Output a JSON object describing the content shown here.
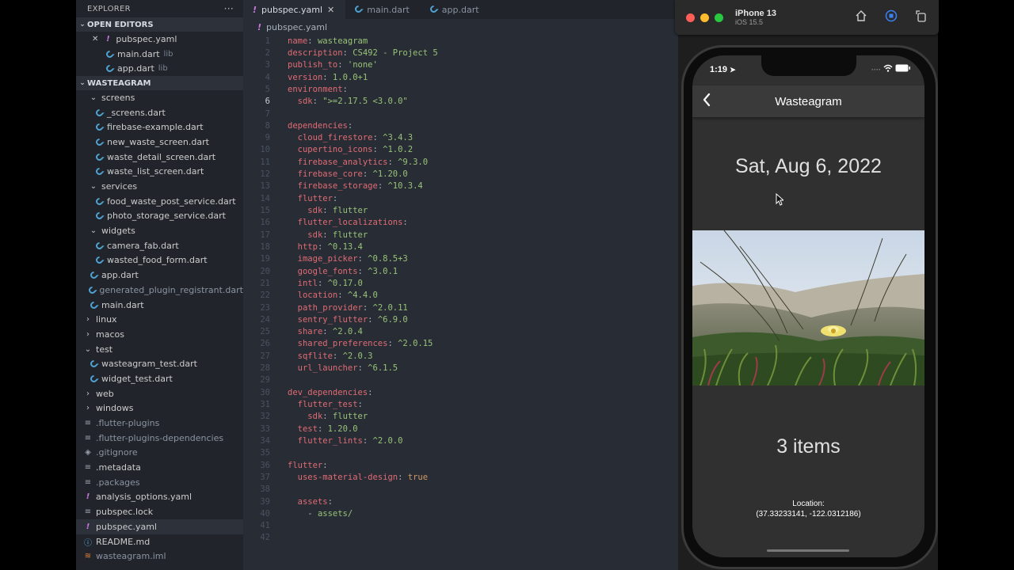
{
  "explorer": {
    "title": "EXPLORER",
    "more": "···",
    "open_editors_label": "OPEN EDITORS",
    "open_editors": [
      {
        "name": "pubspec.yaml",
        "sub": "",
        "icon": "yaml-icon"
      },
      {
        "name": "main.dart",
        "sub": "lib",
        "icon": "dart-icon"
      },
      {
        "name": "app.dart",
        "sub": "lib",
        "icon": "dart-icon"
      }
    ],
    "project_label": "WASTEAGRAM",
    "tree": [
      {
        "name": "screens",
        "type": "folder-open",
        "indent": 1
      },
      {
        "name": "_screens.dart",
        "type": "dart",
        "indent": 2
      },
      {
        "name": "firebase-example.dart",
        "type": "dart",
        "indent": 2
      },
      {
        "name": "new_waste_screen.dart",
        "type": "dart",
        "indent": 2
      },
      {
        "name": "waste_detail_screen.dart",
        "type": "dart",
        "indent": 2
      },
      {
        "name": "waste_list_screen.dart",
        "type": "dart",
        "indent": 2
      },
      {
        "name": "services",
        "type": "folder-open",
        "indent": 1
      },
      {
        "name": "food_waste_post_service.dart",
        "type": "dart",
        "indent": 2
      },
      {
        "name": "photo_storage_service.dart",
        "type": "dart",
        "indent": 2
      },
      {
        "name": "widgets",
        "type": "folder-open",
        "indent": 1
      },
      {
        "name": "camera_fab.dart",
        "type": "dart",
        "indent": 2
      },
      {
        "name": "wasted_food_form.dart",
        "type": "dart",
        "indent": 2
      },
      {
        "name": "app.dart",
        "type": "dart",
        "indent": 1
      },
      {
        "name": "generated_plugin_registrant.dart",
        "type": "dart-dim",
        "indent": 1
      },
      {
        "name": "main.dart",
        "type": "dart",
        "indent": 1
      },
      {
        "name": "linux",
        "type": "folder",
        "indent": 0
      },
      {
        "name": "macos",
        "type": "folder",
        "indent": 0
      },
      {
        "name": "test",
        "type": "folder-open",
        "indent": 0
      },
      {
        "name": "wasteagram_test.dart",
        "type": "dart",
        "indent": 1
      },
      {
        "name": "widget_test.dart",
        "type": "dart",
        "indent": 1
      },
      {
        "name": "web",
        "type": "folder",
        "indent": 0
      },
      {
        "name": "windows",
        "type": "folder",
        "indent": 0
      },
      {
        "name": ".flutter-plugins",
        "type": "lines-dim",
        "indent": 0
      },
      {
        "name": ".flutter-plugins-dependencies",
        "type": "lines-dim",
        "indent": 0
      },
      {
        "name": ".gitignore",
        "type": "git-dim",
        "indent": 0
      },
      {
        "name": ".metadata",
        "type": "lines",
        "indent": 0
      },
      {
        "name": ".packages",
        "type": "lines-dim",
        "indent": 0
      },
      {
        "name": "analysis_options.yaml",
        "type": "yaml",
        "indent": 0
      },
      {
        "name": "pubspec.lock",
        "type": "lines",
        "indent": 0
      },
      {
        "name": "pubspec.yaml",
        "type": "yaml",
        "indent": 0,
        "active": true
      },
      {
        "name": "README.md",
        "type": "info",
        "indent": 0
      },
      {
        "name": "wasteagram.iml",
        "type": "rss-dim",
        "indent": 0
      }
    ]
  },
  "tabs": [
    {
      "label": "pubspec.yaml",
      "active": true,
      "icon": "yaml-icon"
    },
    {
      "label": "main.dart",
      "active": false,
      "icon": "dart-icon"
    },
    {
      "label": "app.dart",
      "active": false,
      "icon": "dart-icon"
    }
  ],
  "breadcrumb": "pubspec.yaml",
  "code": {
    "current_line": 6,
    "lines": [
      [
        [
          "k",
          "name"
        ],
        [
          "p",
          ": "
        ],
        [
          "s",
          "wasteagram"
        ]
      ],
      [
        [
          "k",
          "description"
        ],
        [
          "p",
          ": "
        ],
        [
          "s",
          "CS492 - Project 5"
        ]
      ],
      [
        [
          "k",
          "publish_to"
        ],
        [
          "p",
          ": "
        ],
        [
          "s",
          "'none'"
        ]
      ],
      [
        [
          "k",
          "version"
        ],
        [
          "p",
          ": "
        ],
        [
          "s",
          "1.0.0+1"
        ]
      ],
      [
        [
          "k",
          "environment"
        ],
        [
          "p",
          ":"
        ]
      ],
      [
        [
          "p",
          "  "
        ],
        [
          "k",
          "sdk"
        ],
        [
          "p",
          ": "
        ],
        [
          "s",
          "\">=2.17.5 <3.0.0\""
        ]
      ],
      [],
      [
        [
          "k",
          "dependencies"
        ],
        [
          "p",
          ":"
        ]
      ],
      [
        [
          "p",
          "  "
        ],
        [
          "k",
          "cloud_firestore"
        ],
        [
          "p",
          ": "
        ],
        [
          "s",
          "^3.4.3"
        ]
      ],
      [
        [
          "p",
          "  "
        ],
        [
          "k",
          "cupertino_icons"
        ],
        [
          "p",
          ": "
        ],
        [
          "s",
          "^1.0.2"
        ]
      ],
      [
        [
          "p",
          "  "
        ],
        [
          "k",
          "firebase_analytics"
        ],
        [
          "p",
          ": "
        ],
        [
          "s",
          "^9.3.0"
        ]
      ],
      [
        [
          "p",
          "  "
        ],
        [
          "k",
          "firebase_core"
        ],
        [
          "p",
          ": "
        ],
        [
          "s",
          "^1.20.0"
        ]
      ],
      [
        [
          "p",
          "  "
        ],
        [
          "k",
          "firebase_storage"
        ],
        [
          "p",
          ": "
        ],
        [
          "s",
          "^10.3.4"
        ]
      ],
      [
        [
          "p",
          "  "
        ],
        [
          "k",
          "flutter"
        ],
        [
          "p",
          ":"
        ]
      ],
      [
        [
          "p",
          "    "
        ],
        [
          "k",
          "sdk"
        ],
        [
          "p",
          ": "
        ],
        [
          "s",
          "flutter"
        ]
      ],
      [
        [
          "p",
          "  "
        ],
        [
          "k",
          "flutter_localizations"
        ],
        [
          "p",
          ":"
        ]
      ],
      [
        [
          "p",
          "    "
        ],
        [
          "k",
          "sdk"
        ],
        [
          "p",
          ": "
        ],
        [
          "s",
          "flutter"
        ]
      ],
      [
        [
          "p",
          "  "
        ],
        [
          "k",
          "http"
        ],
        [
          "p",
          ": "
        ],
        [
          "s",
          "^0.13.4"
        ]
      ],
      [
        [
          "p",
          "  "
        ],
        [
          "k",
          "image_picker"
        ],
        [
          "p",
          ": "
        ],
        [
          "s",
          "^0.8.5+3"
        ]
      ],
      [
        [
          "p",
          "  "
        ],
        [
          "k",
          "google_fonts"
        ],
        [
          "p",
          ": "
        ],
        [
          "s",
          "^3.0.1"
        ]
      ],
      [
        [
          "p",
          "  "
        ],
        [
          "k",
          "intl"
        ],
        [
          "p",
          ": "
        ],
        [
          "s",
          "^0.17.0"
        ]
      ],
      [
        [
          "p",
          "  "
        ],
        [
          "k",
          "location"
        ],
        [
          "p",
          ": "
        ],
        [
          "s",
          "^4.4.0"
        ]
      ],
      [
        [
          "p",
          "  "
        ],
        [
          "k",
          "path_provider"
        ],
        [
          "p",
          ": "
        ],
        [
          "s",
          "^2.0.11"
        ]
      ],
      [
        [
          "p",
          "  "
        ],
        [
          "k",
          "sentry_flutter"
        ],
        [
          "p",
          ": "
        ],
        [
          "s",
          "^6.9.0"
        ]
      ],
      [
        [
          "p",
          "  "
        ],
        [
          "k",
          "share"
        ],
        [
          "p",
          ": "
        ],
        [
          "s",
          "^2.0.4"
        ]
      ],
      [
        [
          "p",
          "  "
        ],
        [
          "k",
          "shared_preferences"
        ],
        [
          "p",
          ": "
        ],
        [
          "s",
          "^2.0.15"
        ]
      ],
      [
        [
          "p",
          "  "
        ],
        [
          "k",
          "sqflite"
        ],
        [
          "p",
          ": "
        ],
        [
          "s",
          "^2.0.3"
        ]
      ],
      [
        [
          "p",
          "  "
        ],
        [
          "k",
          "url_launcher"
        ],
        [
          "p",
          ": "
        ],
        [
          "s",
          "^6.1.5"
        ]
      ],
      [],
      [
        [
          "k",
          "dev_dependencies"
        ],
        [
          "p",
          ":"
        ]
      ],
      [
        [
          "p",
          "  "
        ],
        [
          "k",
          "flutter_test"
        ],
        [
          "p",
          ":"
        ]
      ],
      [
        [
          "p",
          "    "
        ],
        [
          "k",
          "sdk"
        ],
        [
          "p",
          ": "
        ],
        [
          "s",
          "flutter"
        ]
      ],
      [
        [
          "p",
          "  "
        ],
        [
          "k",
          "test"
        ],
        [
          "p",
          ": "
        ],
        [
          "s",
          "1.20.0"
        ]
      ],
      [
        [
          "p",
          "  "
        ],
        [
          "k",
          "flutter_lints"
        ],
        [
          "p",
          ": "
        ],
        [
          "s",
          "^2.0.0"
        ]
      ],
      [],
      [
        [
          "k",
          "flutter"
        ],
        [
          "p",
          ":"
        ]
      ],
      [
        [
          "p",
          "  "
        ],
        [
          "k",
          "uses-material-design"
        ],
        [
          "p",
          ": "
        ],
        [
          "n",
          "true"
        ]
      ],
      [],
      [
        [
          "p",
          "  "
        ],
        [
          "k",
          "assets"
        ],
        [
          "p",
          ":"
        ]
      ],
      [
        [
          "p",
          "    - "
        ],
        [
          "s",
          "assets/"
        ]
      ],
      [],
      []
    ]
  },
  "simulator": {
    "device": "iPhone 13",
    "os": "iOS 15.5",
    "toolbar_icons": [
      "home-icon",
      "screenshot-icon",
      "rotate-icon"
    ],
    "traffic_lights": {
      "close": "#ff5f57",
      "minimize": "#febc2e",
      "zoom": "#28c840"
    }
  },
  "phone": {
    "time": "1:19",
    "app_title": "Wasteagram",
    "date": "Sat, Aug 6, 2022",
    "items": "3 items",
    "location_label": "Location:",
    "location_value": "(37.33233141, -122.0312186)"
  },
  "colors": {
    "sidebar_bg": "#21252b",
    "editor_bg": "#282c34",
    "key": "#e06c75",
    "string": "#98c379",
    "boolean": "#d19a66",
    "app_bg": "#303030",
    "appbar_bg": "#3a3a3a"
  }
}
